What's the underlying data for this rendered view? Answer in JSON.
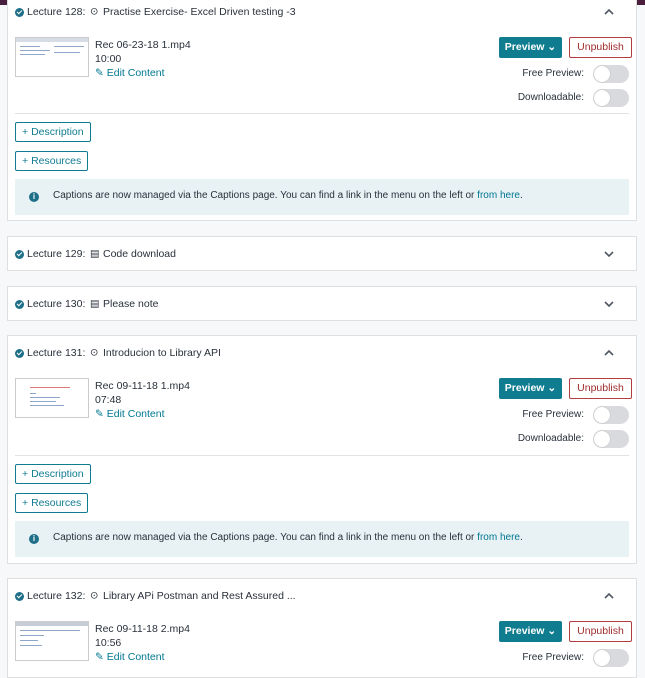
{
  "colors": {
    "accent": "#0f7c90",
    "unpublish": "#a02c2c",
    "check": "#1e6f88",
    "caption_bg": "#e8f2f5"
  },
  "lectures": [
    {
      "num": "Lecture 128:",
      "type": "video",
      "type_icon": "play-circle-icon",
      "type_glyph": "⊙",
      "title": "Practise Exercise- Excel Driven testing -3",
      "chevron": "⌃",
      "file": "Rec 06-23-18 1.mp4",
      "duration": "10:00",
      "edit": "Edit Content",
      "preview": "Preview",
      "unpublish": "Unpublish",
      "free_preview": "Free Preview:",
      "downloadable": "Downloadable:",
      "description": "Description",
      "resources": "Resources",
      "caption_text": "Captions are now managed via the Captions page. You can find a link in the menu on the left or ",
      "caption_link": "from here",
      "caption_end": "."
    },
    {
      "num": "Lecture 129:",
      "type": "article",
      "type_icon": "document-icon",
      "type_glyph": "▤",
      "title": "Code download",
      "chevron": "⌄"
    },
    {
      "num": "Lecture 130:",
      "type": "article",
      "type_icon": "document-icon",
      "type_glyph": "▤",
      "title": "Please note",
      "chevron": "⌄"
    },
    {
      "num": "Lecture 131:",
      "type": "video",
      "type_icon": "play-circle-icon",
      "type_glyph": "⊙",
      "title": "Introducion to Library API",
      "chevron": "⌃",
      "file": "Rec 09-11-18 1.mp4",
      "duration": "07:48",
      "edit": "Edit Content",
      "preview": "Preview",
      "unpublish": "Unpublish",
      "free_preview": "Free Preview:",
      "downloadable": "Downloadable:",
      "description": "Description",
      "resources": "Resources",
      "caption_text": "Captions are now managed via the Captions page. You can find a link in the menu on the left or ",
      "caption_link": "from here",
      "caption_end": "."
    },
    {
      "num": "Lecture 132:",
      "type": "video",
      "type_icon": "play-circle-icon",
      "type_glyph": "⊙",
      "title": "Library APi Postman and Rest Assured ...",
      "chevron": "⌃",
      "file": "Rec 09-11-18 2.mp4",
      "duration": "10:56",
      "edit": "Edit Content",
      "preview": "Preview",
      "unpublish": "Unpublish",
      "free_preview": "Free Preview:"
    }
  ],
  "glyphs": {
    "check": "✓",
    "pencil": "✎",
    "plus": "+",
    "caret": "⌄",
    "info": "i"
  }
}
